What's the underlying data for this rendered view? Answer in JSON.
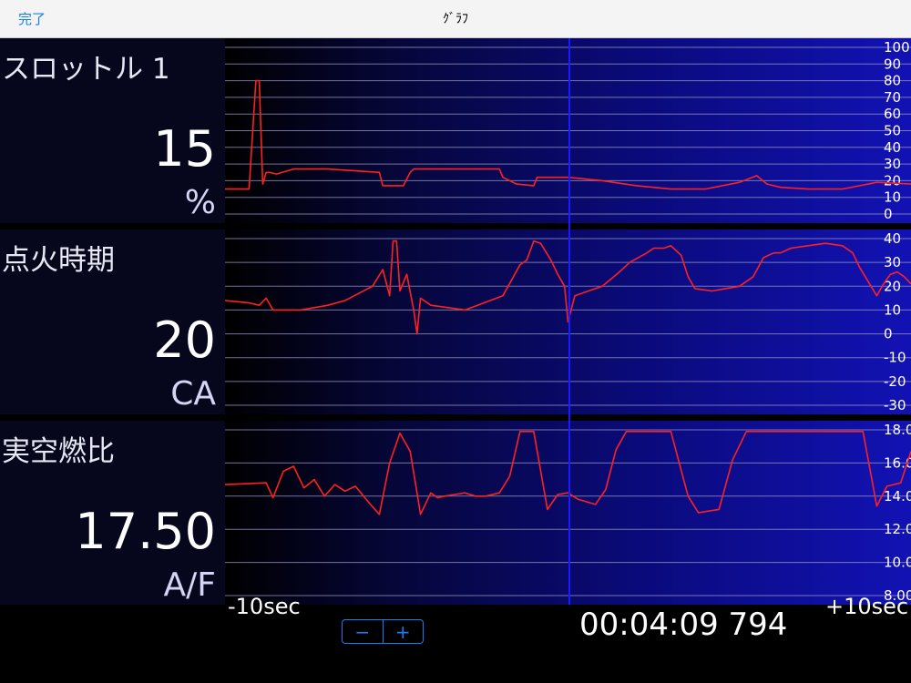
{
  "navbar": {
    "done_label": "完了",
    "title": "ｸﾞﾗﾌ"
  },
  "panels": [
    {
      "name": "スロットル 1",
      "value": "15",
      "unit": "%"
    },
    {
      "name": "点火時期",
      "value": "20",
      "unit": "CA"
    },
    {
      "name": "実空燃比",
      "value": "17.50",
      "unit": "A/F"
    }
  ],
  "footer": {
    "x_start": "-10sec",
    "x_end": "+10sec",
    "minus_label": "−",
    "plus_label": "+",
    "timestamp": "00:04:09 794"
  },
  "colors": {
    "line": "#ff2020",
    "cursor": "#1a1aff",
    "accent": "#1a7cf4"
  },
  "chart_data": [
    {
      "type": "line",
      "series": [
        {
          "name": "スロットル 1",
          "x": [
            -10,
            -9.3,
            -9.1,
            -9.0,
            -8.9,
            -8.8,
            -8.7,
            -8.5,
            -8.0,
            -7.0,
            -5.5,
            -5.4,
            -5.2,
            -4.8,
            -4.6,
            -4.5,
            -2.0,
            -1.9,
            -1.5,
            -1.0,
            -0.9,
            0,
            1.0,
            2.0,
            3.0,
            4.0,
            5.0,
            5.5,
            5.8,
            6.2,
            7.0,
            8.0,
            9.0,
            10.0
          ],
          "values": [
            15,
            15,
            80,
            80,
            18,
            25,
            25,
            24,
            27,
            27,
            25,
            17,
            17,
            17,
            25,
            27,
            27,
            22,
            18,
            17,
            22,
            22,
            20,
            17,
            15,
            15,
            19,
            23,
            18,
            16,
            15,
            15,
            19,
            18
          ]
        }
      ],
      "ylim": [
        0,
        100
      ],
      "yticks": [
        "100",
        "90",
        "80",
        "70",
        "60",
        "50",
        "40",
        "30",
        "20",
        "10",
        "0"
      ],
      "x_range": [
        -10,
        10
      ]
    },
    {
      "type": "line",
      "series": [
        {
          "name": "点火時期",
          "x": [
            -10,
            -9.3,
            -9.0,
            -8.8,
            -8.6,
            -7.8,
            -7.0,
            -6.5,
            -5.7,
            -5.4,
            -5.2,
            -5.1,
            -5.0,
            -4.9,
            -4.7,
            -4.5,
            -4.4,
            -4.3,
            -4.0,
            -3.0,
            -1.9,
            -1.4,
            -1.3,
            -1.2,
            -1.0,
            -0.8,
            -0.5,
            -0.3,
            -0.1,
            0,
            0.2,
            1.0,
            1.5,
            1.8,
            2.3,
            2.5,
            2.8,
            3.0,
            3.3,
            3.5,
            3.7,
            4.2,
            5.0,
            5.4,
            5.7,
            6.0,
            6.2,
            6.5,
            7.0,
            7.5,
            8.0,
            8.3,
            8.5,
            9.0,
            9.2,
            9.4,
            9.6,
            9.8,
            10.0
          ],
          "values": [
            14,
            13,
            12,
            15,
            10,
            10,
            12,
            14,
            20,
            27,
            16,
            39,
            39,
            18,
            25,
            10,
            0,
            15,
            12,
            10,
            16,
            29,
            30,
            31,
            39,
            38,
            31,
            25,
            20,
            5,
            16,
            20,
            26,
            30,
            34,
            36,
            36,
            37,
            33,
            24,
            19,
            18,
            20,
            24,
            32,
            34,
            34,
            36,
            37,
            38,
            37,
            34,
            28,
            16,
            21,
            25,
            26,
            24,
            21
          ]
        }
      ],
      "ylim": [
        -30,
        40
      ],
      "yticks": [
        "40",
        "30",
        "20",
        "10",
        "0",
        "-10",
        "-20",
        "-30"
      ],
      "x_range": [
        -10,
        10
      ]
    },
    {
      "type": "line",
      "series": [
        {
          "name": "実空燃比",
          "x": [
            -10,
            -8.8,
            -8.6,
            -8.3,
            -8.0,
            -7.7,
            -7.4,
            -7.1,
            -6.8,
            -6.5,
            -6.2,
            -5.8,
            -5.5,
            -5.2,
            -4.9,
            -4.6,
            -4.3,
            -4.0,
            -3.8,
            -3.6,
            -3.3,
            -3.0,
            -2.7,
            -2.4,
            -2.0,
            -1.7,
            -1.4,
            -1.0,
            -0.6,
            -0.3,
            0,
            0.3,
            0.8,
            1.1,
            1.4,
            1.7,
            2.0,
            2.5,
            3.0,
            3.5,
            3.8,
            4.1,
            4.4,
            4.8,
            5.2,
            5.6,
            6.0,
            6.5,
            7.0,
            7.5,
            8.0,
            8.6,
            9.0,
            9.3,
            9.5,
            9.7,
            10.0
          ],
          "values": [
            14.7,
            14.8,
            13.9,
            15.5,
            15.8,
            14.5,
            15.0,
            14.0,
            14.7,
            14.3,
            14.6,
            13.6,
            12.9,
            16.0,
            17.8,
            16.7,
            12.9,
            14.2,
            13.9,
            14.0,
            14.1,
            14.2,
            14.0,
            14.0,
            14.2,
            15.2,
            17.9,
            17.9,
            13.2,
            14.1,
            14.2,
            13.8,
            13.5,
            14.4,
            16.8,
            17.9,
            17.9,
            17.9,
            17.9,
            14.0,
            13.0,
            13.1,
            13.2,
            16.2,
            17.9,
            17.9,
            17.9,
            17.9,
            17.9,
            17.9,
            17.9,
            17.9,
            13.4,
            14.6,
            14.7,
            14.8,
            16.7
          ]
        }
      ],
      "ylim": [
        8,
        18
      ],
      "yticks": [
        "18.00",
        "16.00",
        "14.00",
        "12.00",
        "10.00",
        "8.00"
      ],
      "x_range": [
        -10,
        10
      ]
    }
  ]
}
